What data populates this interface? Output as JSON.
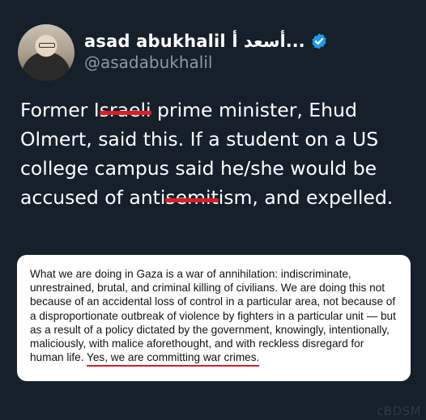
{
  "author": {
    "display_name": "asad abukhalil أسعد أ...",
    "handle": "@asadabukhalil",
    "verified_icon": "verified-badge-icon",
    "verified_color": "#1d9bf0"
  },
  "tweet": {
    "line1_pre": "Former I",
    "line1_struck": "sraeli",
    "line1_post": " prime minister, Ehud",
    "line2": "Olmert, said this.  If a student on a US",
    "line3": "college campus said he/she would be",
    "line4_pre": "accused of anti",
    "line4_struck": "semit",
    "line4_post": "ism, and expelled."
  },
  "quote": {
    "line1": "What we are doing in Gaza is a war of annihilation: indiscriminate,",
    "line2": "unrestrained, brutal, and criminal killing of civilians. We are doing this not",
    "line3": "because of an accidental loss of control in a particular area, not because of",
    "line4": "a disproportionate outbreak of violence by fighters in a particular unit — but",
    "line5": "as a result of a policy dictated by the government, knowingly, intentionally,",
    "line6": "maliciously, with malice aforethought, and with reckless disregard for",
    "line7_pre": "human life. ",
    "line7_underlined": "Yes, we are committing war crimes.",
    "underline_color": "#d91e2a"
  },
  "watermark": "cBDSM",
  "colors": {
    "background": "#15202b",
    "text": "#ffffff",
    "handle": "#8b98a5",
    "strike": "#d91e2a"
  }
}
